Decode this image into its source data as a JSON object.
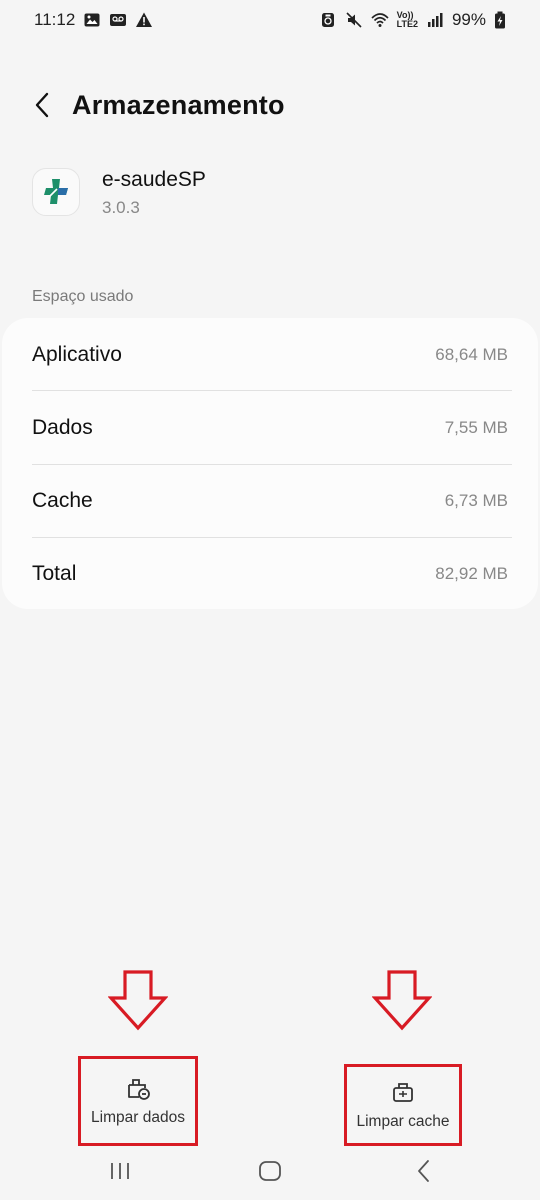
{
  "status_bar": {
    "time": "11:12",
    "battery_percent": "99%",
    "network_label_top": "Vo))",
    "network_label_bottom": "LTE2",
    "left_icons": [
      "image-icon",
      "voicemail-icon",
      "warning-icon"
    ],
    "right_icons": [
      "recycle-icon",
      "mute-icon",
      "wifi-icon",
      "signal-icon",
      "battery-charging-icon"
    ]
  },
  "header": {
    "title": "Armazenamento",
    "back_icon": "chevron-left-icon"
  },
  "app": {
    "name": "e-saudeSP",
    "version": "3.0.3",
    "icon": "health-cross-icon",
    "icon_colors": [
      "#1e8f6a",
      "#2a6ea8"
    ]
  },
  "storage": {
    "section_label": "Espaço usado",
    "rows": [
      {
        "label": "Aplicativo",
        "value": "68,64 MB"
      },
      {
        "label": "Dados",
        "value": "7,55 MB"
      },
      {
        "label": "Cache",
        "value": "6,73 MB"
      },
      {
        "label": "Total",
        "value": "82,92 MB"
      }
    ]
  },
  "actions": {
    "clear_data": {
      "label": "Limpar dados",
      "icon": "clear-data-icon"
    },
    "clear_cache": {
      "label": "Limpar cache",
      "icon": "clear-cache-icon"
    }
  },
  "annotations": {
    "highlight_color": "#d81b24",
    "arrow_icon": "down-arrow-icon"
  },
  "nav_bar": {
    "recents_icon": "recents-icon",
    "home_icon": "home-icon",
    "back_icon": "back-icon"
  }
}
